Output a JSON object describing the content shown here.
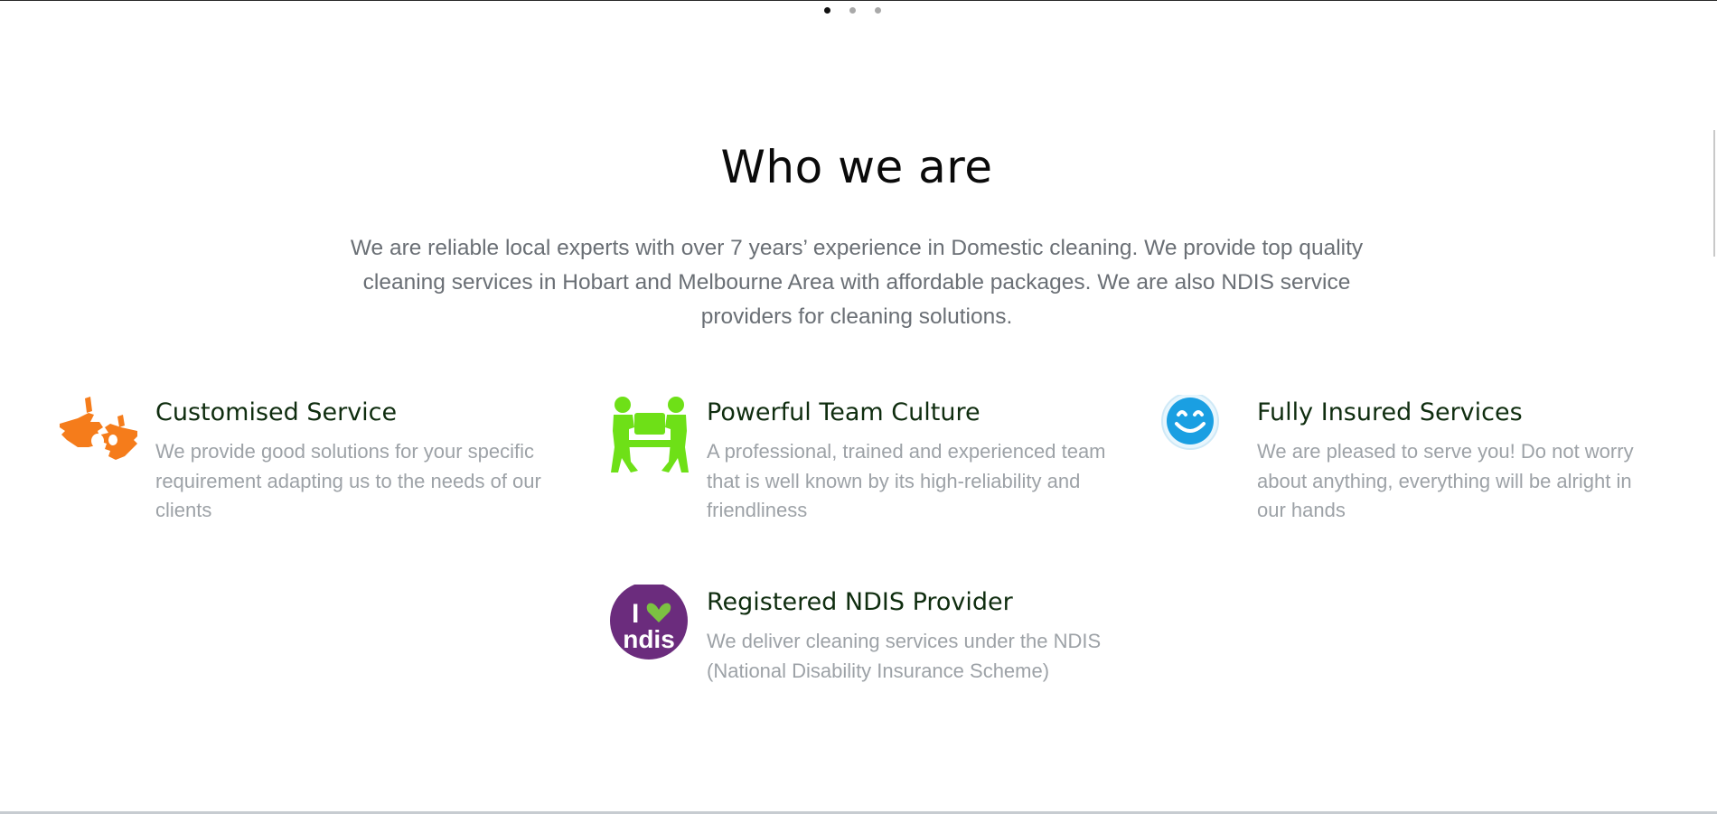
{
  "slider": {
    "dots": [
      "slide-1",
      "slide-2",
      "slide-3"
    ],
    "active_index": 0
  },
  "about": {
    "title": "Who we are",
    "intro": "We are reliable local experts with over 7 years’ experience in Domestic cleaning. We provide top quality cleaning services in Hobart and Melbourne Area with affordable packages. We are also NDIS service providers for cleaning solutions."
  },
  "features": [
    {
      "icon": "hands-sign-icon",
      "title": "Customised Service",
      "text": "We provide good solutions for your specific requirement adapting us to the needs of our clients"
    },
    {
      "icon": "team-carry-icon",
      "title": "Powerful Team Culture",
      "text": "A professional, trained and experienced team that is well known by its high-reliability and friendliness"
    },
    {
      "icon": "smiley-icon",
      "title": "Fully Insured Services",
      "text": "We are pleased to serve you! Do not worry about anything, everything will be alright in our hands"
    },
    {
      "icon": "ndis-logo-icon",
      "title": "Registered NDIS Provider",
      "text": "We deliver cleaning services under the NDIS (National Disability Insurance Scheme)",
      "logo_text": {
        "line1": "I",
        "line2": "ndis"
      }
    }
  ],
  "colors": {
    "title": "#0a0a0a",
    "intro_text": "#6a6f75",
    "feature_title": "#0f2d0f",
    "feature_text": "#9da2a7",
    "icon_orange": "#f57c1b",
    "icon_green": "#6ee017",
    "icon_blue": "#1a9fe2",
    "ndis_purple": "#6b2c7d",
    "ndis_heart": "#7cc142"
  }
}
